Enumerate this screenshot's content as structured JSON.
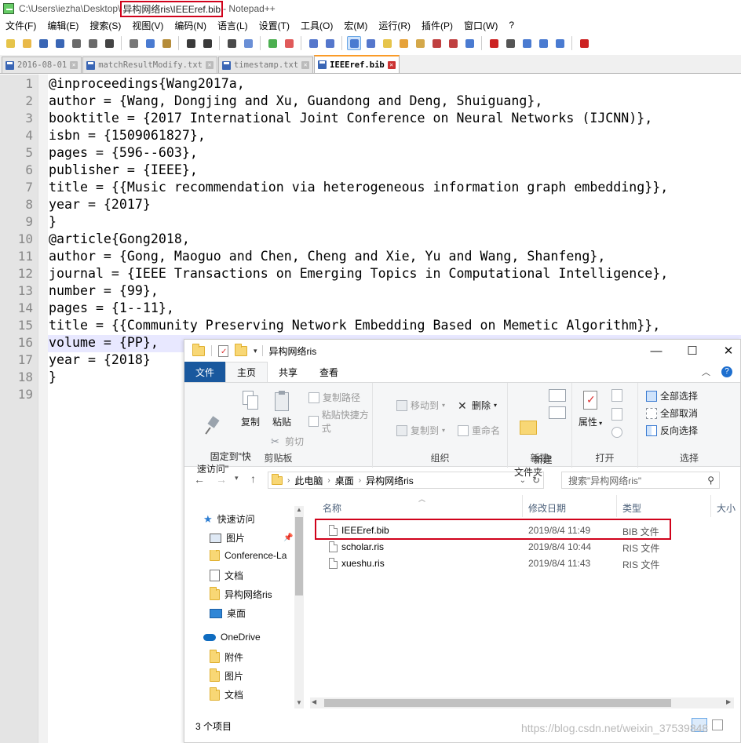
{
  "window": {
    "title_path_prefix": "C:\\Users\\iezha\\Desktop\\",
    "title_highlight": "异构网络ris\\IEEEref.bib",
    "title_suffix": " - Notepad++"
  },
  "menu": [
    "文件(F)",
    "编辑(E)",
    "搜索(S)",
    "视图(V)",
    "编码(N)",
    "语言(L)",
    "设置(T)",
    "工具(O)",
    "宏(M)",
    "运行(R)",
    "插件(P)",
    "窗口(W)",
    "?"
  ],
  "toolbar_icons": [
    "new-icon",
    "open-icon",
    "save-icon",
    "save-all-icon",
    "close-icon",
    "close-all-icon",
    "print-icon",
    "cut-icon",
    "copy-icon",
    "paste-icon",
    "undo-icon",
    "redo-icon",
    "find-icon",
    "replace-icon",
    "zoom-in-icon",
    "zoom-out-icon",
    "sync-v-icon",
    "sync-h-icon",
    "wrap-icon",
    "all-chars-icon",
    "indent-guide-icon",
    "udl-icon",
    "doc-map-icon",
    "function-list-icon",
    "folder-workspace-icon",
    "monitor-icon",
    "record-icon",
    "stop-icon",
    "play-icon",
    "play-multi-icon",
    "save-macro-icon",
    "spellcheck-icon"
  ],
  "tabs": [
    {
      "label": "2016-08-01",
      "active": false
    },
    {
      "label": "matchResultModify.txt",
      "active": false
    },
    {
      "label": "timestamp.txt",
      "active": false
    },
    {
      "label": "IEEEref.bib",
      "active": true
    }
  ],
  "editor": {
    "lines": [
      "@inproceedings{Wang2017a,",
      "author = {Wang, Dongjing and Xu, Guandong and Deng, Shuiguang},",
      "booktitle = {2017 International Joint Conference on Neural Networks (IJCNN)},",
      "isbn = {1509061827},",
      "pages = {596--603},",
      "publisher = {IEEE},",
      "title = {{Music recommendation via heterogeneous information graph embedding}},",
      "year = {2017}",
      "}",
      "@article{Gong2018,",
      "author = {Gong, Maoguo and Chen, Cheng and Xie, Yu and Wang, Shanfeng},",
      "journal = {IEEE Transactions on Emerging Topics in Computational Intelligence},",
      "number = {99},",
      "pages = {1--11},",
      "title = {{Community Preserving Network Embedding Based on Memetic Algorithm}},",
      "volume = {PP},",
      "year = {2018}",
      "}",
      ""
    ],
    "line_numbers": [
      "1",
      "2",
      "3",
      "4",
      "5",
      "6",
      "7",
      "8",
      "9",
      "10",
      "11",
      "12",
      "13",
      "14",
      "15",
      "16",
      "17",
      "18",
      "19"
    ]
  },
  "explorer": {
    "title": "异构网络ris",
    "window_buttons": {
      "minimize": "—",
      "maximize": "☐",
      "close": "✕"
    },
    "ribbon_tabs": [
      "文件",
      "主页",
      "共享",
      "查看"
    ],
    "ribbon": {
      "clipboard": {
        "pin": "固定到\"快\n速访问\"",
        "copy": "复制",
        "paste": "粘贴",
        "copy_path": "复制路径",
        "paste_shortcut": "粘贴快捷方式",
        "cut": "剪切",
        "label": "剪贴板"
      },
      "organize": {
        "move_to": "移动到",
        "delete": "删除",
        "copy_to": "复制到",
        "rename": "重命名",
        "label": "组织"
      },
      "new": {
        "new_folder": "新建\n文件夹",
        "label": "新建"
      },
      "open": {
        "properties": "属性",
        "label": "打开"
      },
      "select": {
        "select_all": "全部选择",
        "select_none": "全部取消",
        "invert": "反向选择",
        "label": "选择"
      }
    },
    "address": {
      "crumbs": [
        "此电脑",
        "桌面",
        "异构网络ris"
      ],
      "search_placeholder": "搜索\"异构网络ris\""
    },
    "nav": [
      {
        "label": "快速访问",
        "icon": "star-icon"
      },
      {
        "label": "图片",
        "icon": "pictures-icon"
      },
      {
        "label": "Conference-La",
        "icon": "folder-icon"
      },
      {
        "label": "文档",
        "icon": "documents-icon"
      },
      {
        "label": "异构网络ris",
        "icon": "folder-icon"
      },
      {
        "label": "桌面",
        "icon": "desktop-icon"
      },
      {
        "label": "OneDrive",
        "icon": "cloud-icon"
      },
      {
        "label": "附件",
        "icon": "folder-icon"
      },
      {
        "label": "图片",
        "icon": "folder-icon"
      },
      {
        "label": "文档",
        "icon": "folder-icon"
      }
    ],
    "columns": [
      "名称",
      "修改日期",
      "类型",
      "大小"
    ],
    "files": [
      {
        "name": "IEEEref.bib",
        "date": "2019/8/4 11:49",
        "type": "BIB 文件"
      },
      {
        "name": "scholar.ris",
        "date": "2019/8/4 10:44",
        "type": "RIS 文件"
      },
      {
        "name": "xueshu.ris",
        "date": "2019/8/4 11:43",
        "type": "RIS 文件"
      }
    ],
    "status": "3 个项目"
  },
  "watermark": "https://blog.csdn.net/weixin_37539848"
}
